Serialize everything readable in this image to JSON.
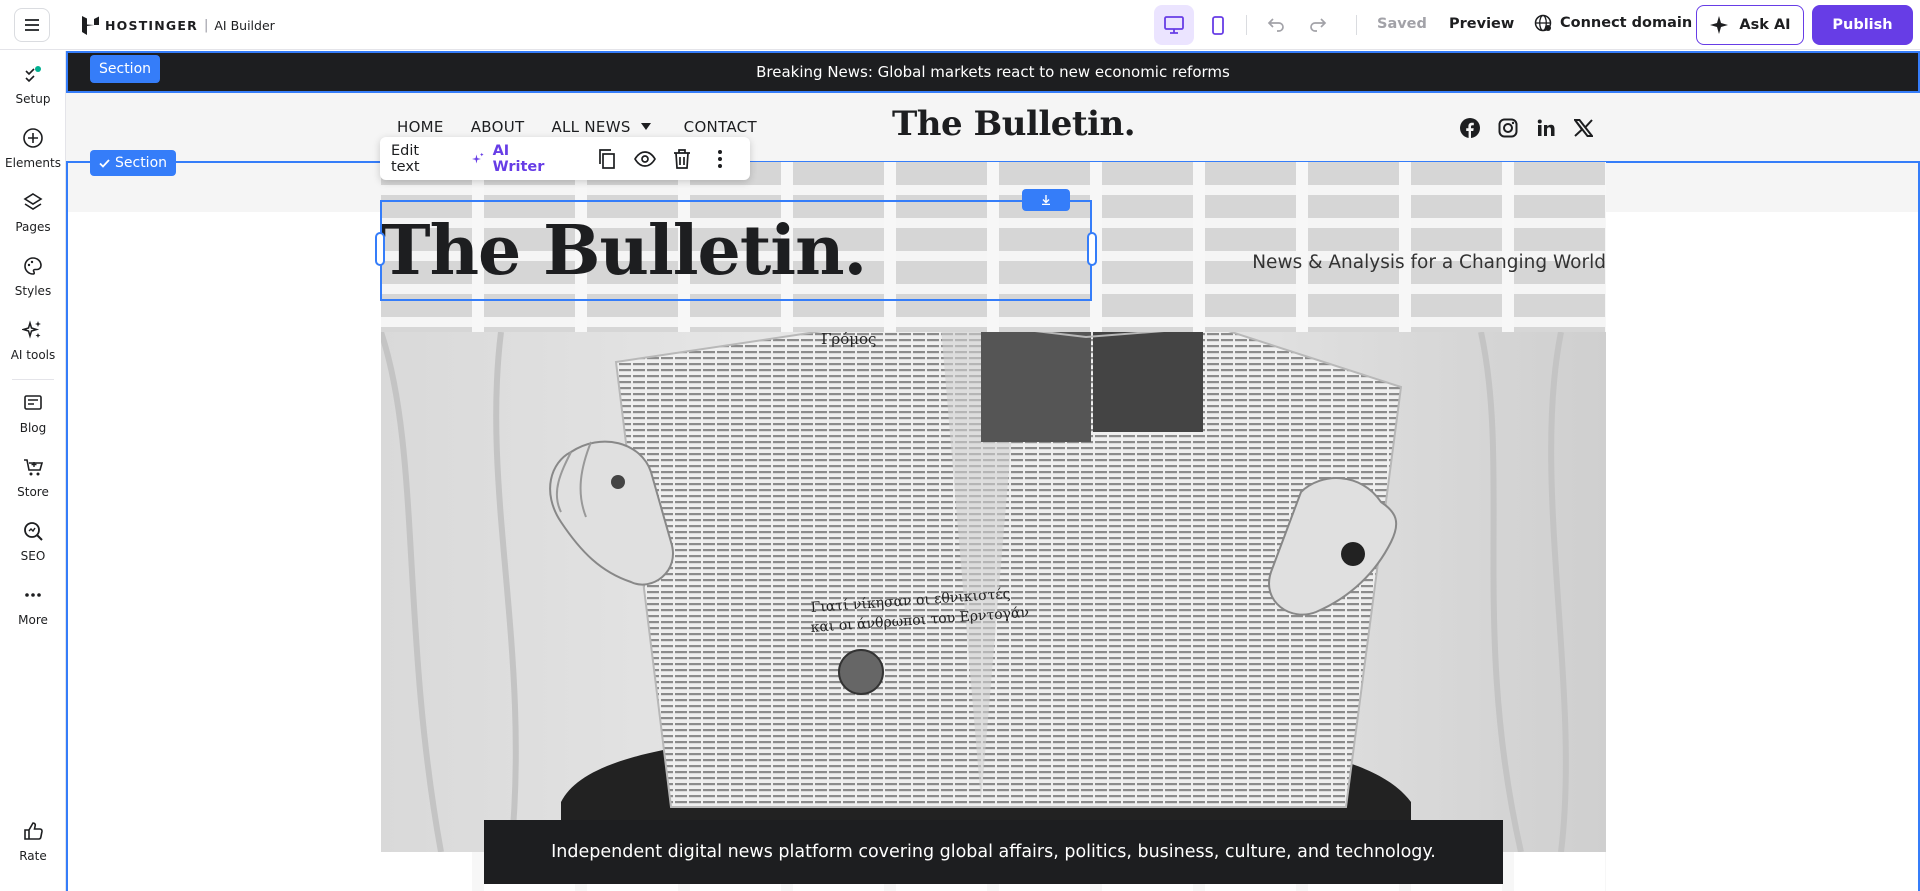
{
  "app": {
    "brand": "HOSTINGER",
    "product": "AI Builder",
    "saved_label": "Saved",
    "preview_label": "Preview",
    "connect_label": "Connect domain",
    "askai_label": "Ask AI",
    "publish_label": "Publish",
    "accent": "#673de6",
    "selection_color": "#357df9"
  },
  "sidebar": {
    "items": [
      {
        "label": "Setup",
        "icon": "setup-icon"
      },
      {
        "label": "Elements",
        "icon": "plus-circle-icon"
      },
      {
        "label": "Pages",
        "icon": "layers-icon"
      },
      {
        "label": "Styles",
        "icon": "palette-icon"
      },
      {
        "label": "AI tools",
        "icon": "sparkles-icon"
      },
      {
        "label": "Blog",
        "icon": "blog-icon"
      },
      {
        "label": "Store",
        "icon": "cart-icon"
      },
      {
        "label": "SEO",
        "icon": "seo-icon"
      },
      {
        "label": "More",
        "icon": "more-icon"
      }
    ],
    "rate_label": "Rate"
  },
  "site": {
    "news_text": "Breaking News: Global markets react to new economic reforms",
    "section_label": "Section",
    "section_label_2": "Section",
    "nav": [
      "HOME",
      "ABOUT",
      "ALL NEWS",
      "CONTACT"
    ],
    "logo": "The Bulletin.",
    "hero_title": "The Bulletin.",
    "tagline": "News & Analysis for a Changing World",
    "caption": "Independent digital news platform covering global affairs, politics, business, culture, and technology.",
    "photo_texts": {
      "top": "Γρόμος",
      "mid1": "Γιατί νίκησαν οι εθνικιστές",
      "mid2": "και οι άνθρωποι του Ερντογάν"
    }
  },
  "toolbar": {
    "edit_text_label": "Edit text",
    "ai_writer_label": "AI Writer"
  }
}
